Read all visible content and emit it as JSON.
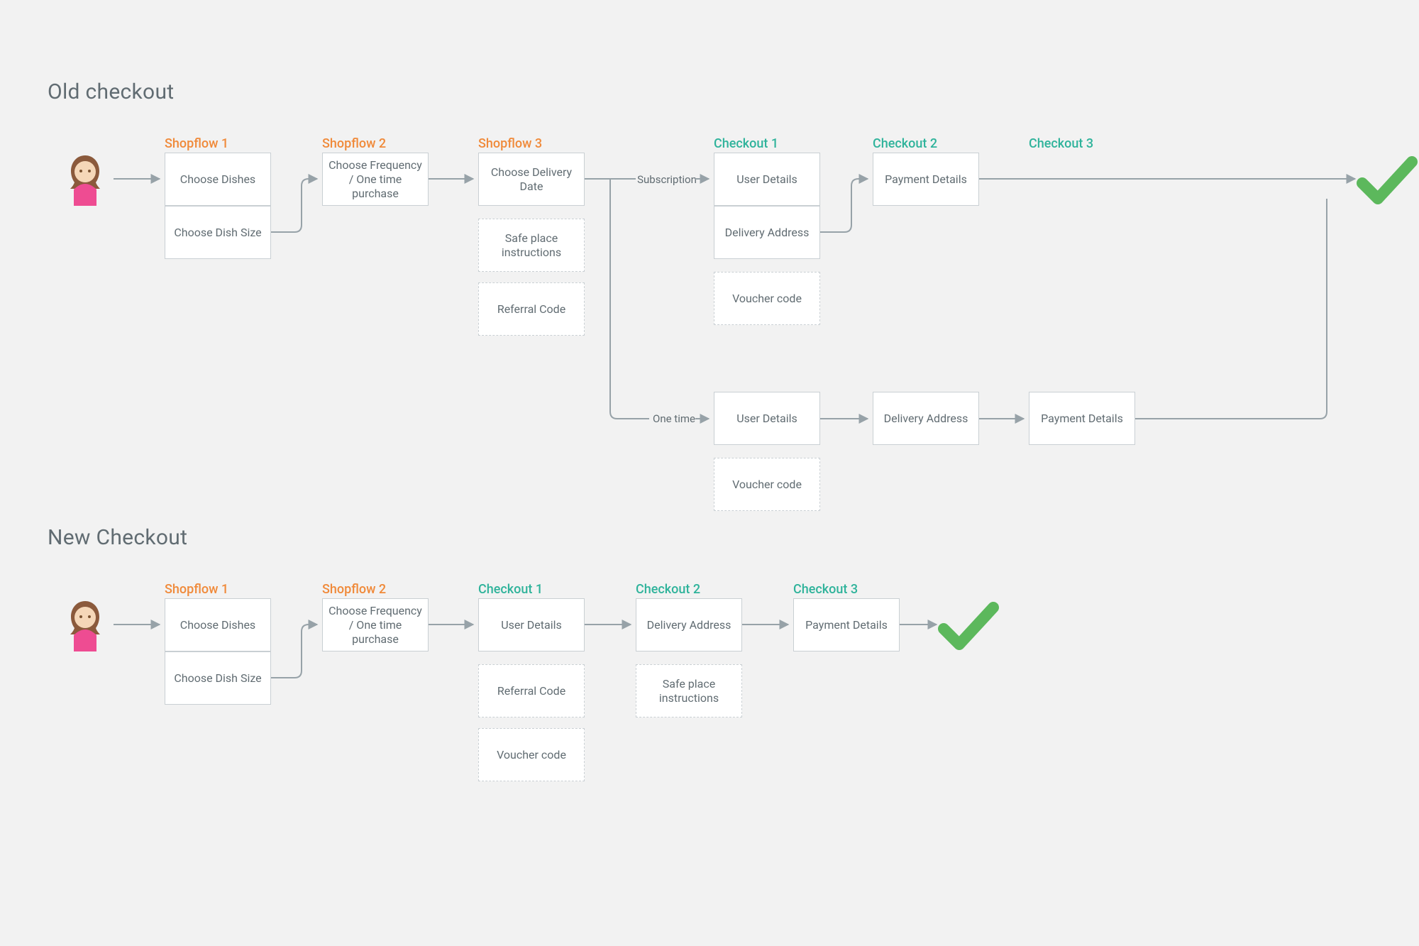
{
  "sections": {
    "old_title": "Old checkout",
    "new_title": "New Checkout"
  },
  "old": {
    "cols": {
      "s1": "Shopflow 1",
      "s2": "Shopflow 2",
      "s3": "Shopflow 3",
      "c1": "Checkout 1",
      "c2": "Checkout 2",
      "c3": "Checkout 3"
    },
    "boxes": {
      "dishes": "Choose Dishes",
      "size": "Choose Dish Size",
      "freq": "Choose Frequency / One time purchase",
      "date": "Choose Delivery Date",
      "safe": "Safe place instructions",
      "ref": "Referral Code",
      "user1": "User Details",
      "addr1": "Delivery Address",
      "voucher1": "Voucher code",
      "pay1": "Payment Details",
      "user2": "User Details",
      "voucher2": "Voucher code",
      "addr2": "Delivery Address",
      "pay2": "Payment Details"
    },
    "edge": {
      "sub": "Subscription",
      "one": "One time"
    }
  },
  "new": {
    "cols": {
      "s1": "Shopflow 1",
      "s2": "Shopflow 2",
      "c1": "Checkout 1",
      "c2": "Checkout 2",
      "c3": "Checkout 3"
    },
    "boxes": {
      "dishes": "Choose Dishes",
      "size": "Choose Dish Size",
      "freq": "Choose Frequency / One time purchase",
      "user": "User Details",
      "ref": "Referral Code",
      "voucher": "Voucher code",
      "addr": "Delivery Address",
      "safe": "Safe place instructions",
      "pay": "Payment Details"
    }
  },
  "colors": {
    "shopflow": "#f08a3a",
    "checkout": "#2fb39b",
    "success": "#5cb85c",
    "arrow": "#97a2a8"
  }
}
